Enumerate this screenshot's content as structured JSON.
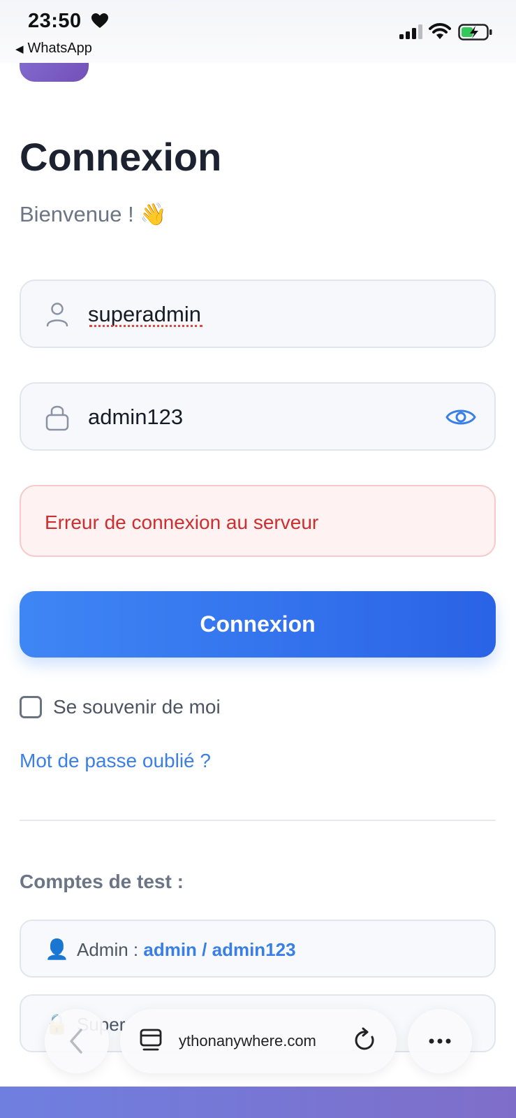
{
  "status_bar": {
    "time": "23:50",
    "back_app": "WhatsApp"
  },
  "login": {
    "title": "Connexion",
    "subtitle": "Bienvenue ! 👋",
    "username": {
      "value": "superadmin",
      "icon": "user-icon"
    },
    "password": {
      "value": "admin123",
      "icon": "lock-icon",
      "toggle_icon": "eye-icon"
    },
    "error_message": "Erreur de connexion au serveur",
    "submit_label": "Connexion",
    "remember_label": "Se souvenir de moi",
    "remember_checked": false,
    "forgot_link": "Mot de passe oublié ?"
  },
  "test_accounts": {
    "title": "Comptes de test :",
    "items": [
      {
        "icon": "👤",
        "label": "Admin : ",
        "credentials": "admin / admin123"
      },
      {
        "icon": "🔒",
        "label": "Super",
        "credentials": ""
      }
    ]
  },
  "browser": {
    "url": "ythonanywhere.com"
  },
  "colors": {
    "accent": "#3a7fe6",
    "button_start": "#3f86f5",
    "button_end": "#2a63e6",
    "error_text": "#cf2e2e",
    "error_bg": "#fef2f2",
    "logo": "#8a78d8"
  }
}
